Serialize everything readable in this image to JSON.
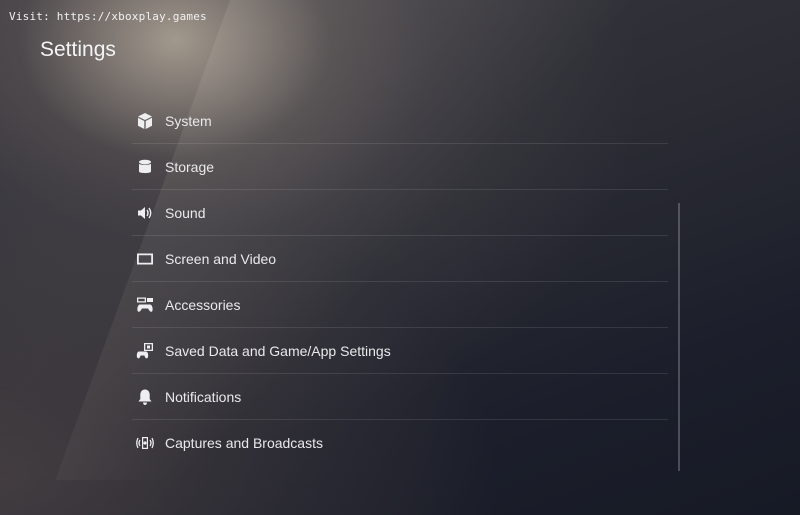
{
  "watermark": "Visit: https://xboxplay.games",
  "page_title": "Settings",
  "menu": {
    "items": [
      {
        "label": "System",
        "icon": "cube-icon"
      },
      {
        "label": "Storage",
        "icon": "storage-icon"
      },
      {
        "label": "Sound",
        "icon": "speaker-icon"
      },
      {
        "label": "Screen and Video",
        "icon": "screen-icon"
      },
      {
        "label": "Accessories",
        "icon": "accessories-icon"
      },
      {
        "label": "Saved Data and Game/App Settings",
        "icon": "saved-data-icon"
      },
      {
        "label": "Notifications",
        "icon": "bell-icon"
      },
      {
        "label": "Captures and Broadcasts",
        "icon": "broadcast-icon"
      }
    ]
  }
}
